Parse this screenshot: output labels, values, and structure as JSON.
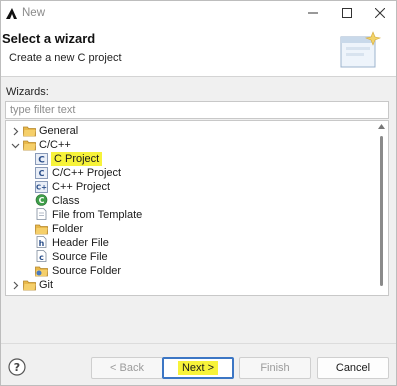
{
  "window": {
    "title": "New"
  },
  "banner": {
    "title": "Select a wizard",
    "subtitle": "Create a new C project"
  },
  "wizards": {
    "label": "Wizards:",
    "filter_placeholder": "type filter text"
  },
  "tree": [
    {
      "label": "General",
      "icon": "folder-icon",
      "expanded": false,
      "depth": 0
    },
    {
      "label": "C/C++",
      "icon": "folder-icon",
      "expanded": true,
      "depth": 0
    },
    {
      "label": "C Project",
      "icon": "c-project-icon",
      "selected": true,
      "depth": 1
    },
    {
      "label": "C/C++ Project",
      "icon": "c-cpp-project-icon",
      "depth": 1
    },
    {
      "label": "C++ Project",
      "icon": "cpp-project-icon",
      "depth": 1
    },
    {
      "label": "Class",
      "icon": "class-icon",
      "depth": 1
    },
    {
      "label": "File from Template",
      "icon": "file-template-icon",
      "depth": 1
    },
    {
      "label": "Folder",
      "icon": "folder-icon",
      "depth": 1
    },
    {
      "label": "Header File",
      "icon": "header-file-icon",
      "depth": 1
    },
    {
      "label": "Source File",
      "icon": "source-file-icon",
      "depth": 1
    },
    {
      "label": "Source Folder",
      "icon": "source-folder-icon",
      "depth": 1
    },
    {
      "label": "Git",
      "icon": "folder-icon",
      "expanded": false,
      "depth": 0
    }
  ],
  "buttons": {
    "back": "< Back",
    "next": "Next >",
    "finish": "Finish",
    "cancel": "Cancel"
  },
  "colors": {
    "highlight": "#f7f33a",
    "focus_border": "#3c76c4",
    "folder": "#e8b84a"
  }
}
